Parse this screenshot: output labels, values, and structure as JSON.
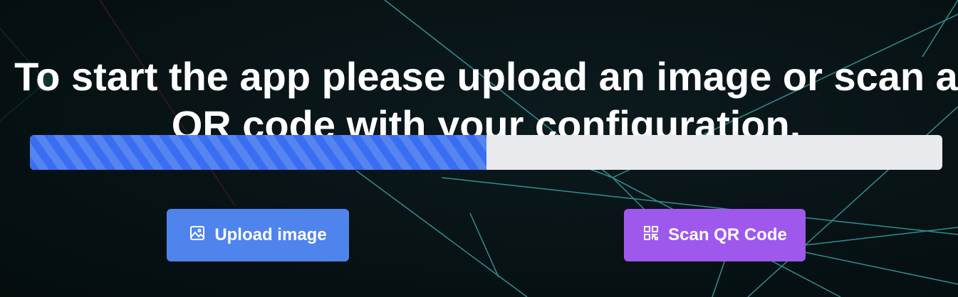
{
  "title": "To start the app please upload an image or scan a QR code with your configuration.",
  "progress": {
    "value_percent": 50,
    "fill_color": "#3a6ef2"
  },
  "buttons": {
    "upload": {
      "label": "Upload image",
      "icon": "image-icon",
      "color": "#4f84ec"
    },
    "scan": {
      "label": "Scan QR Code",
      "icon": "qr-code-icon",
      "color": "#9f58ec"
    }
  }
}
